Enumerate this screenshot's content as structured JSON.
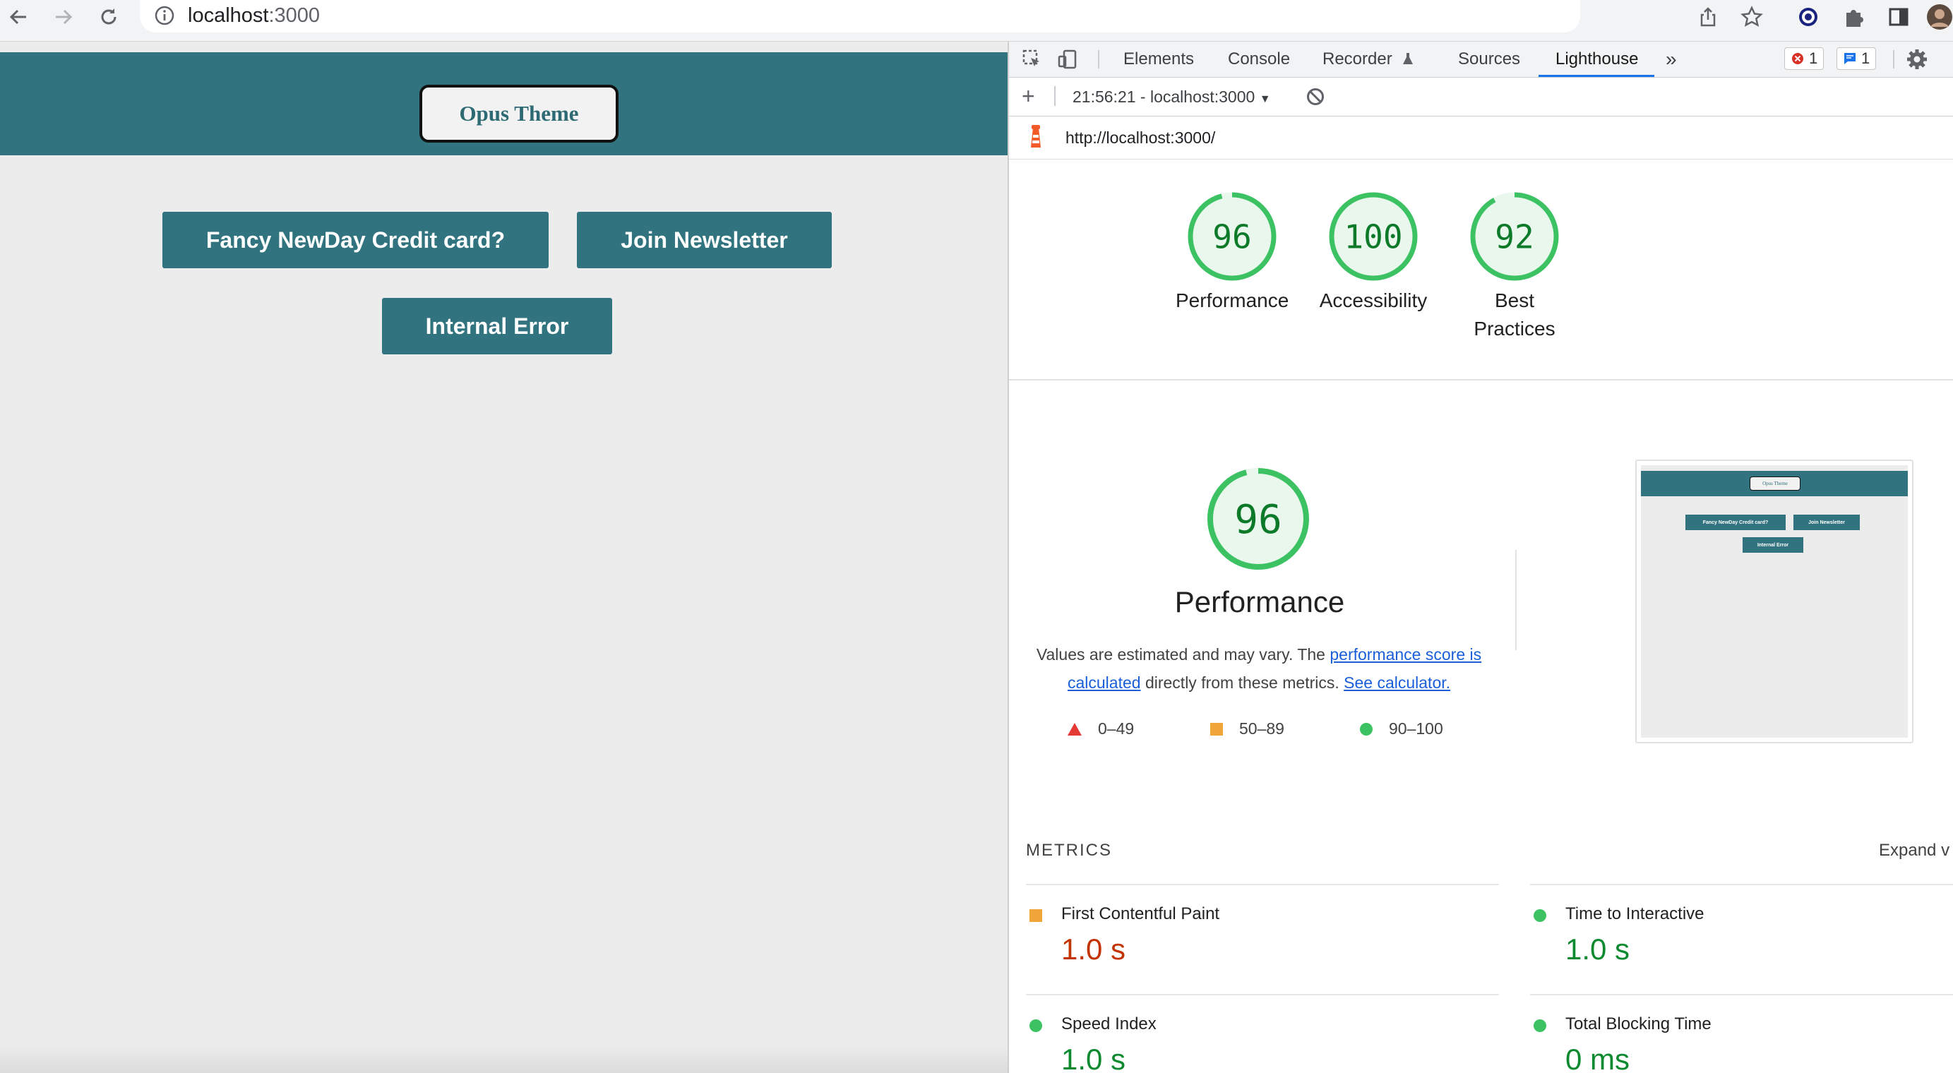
{
  "browser": {
    "url_host": "localhost",
    "url_port": ":3000"
  },
  "page": {
    "header_button": "Opus Theme",
    "buttons": [
      "Fancy NewDay Credit card?",
      "Join Newsletter",
      "Internal Error"
    ]
  },
  "devtools": {
    "tabs": [
      "Elements",
      "Console",
      "Recorder",
      "Sources",
      "Lighthouse"
    ],
    "active_tab": "Lighthouse",
    "error_count": "1",
    "message_count": "1",
    "report_selector": "21:56:21 - localhost:3000",
    "report_url": "http://localhost:3000/",
    "scores": [
      {
        "value": "96",
        "label": "Performance",
        "score": 96
      },
      {
        "value": "100",
        "label": "Accessibility",
        "score": 100
      },
      {
        "value": "92",
        "label": "Best Practices",
        "score": 92
      }
    ],
    "performance": {
      "score_text": "96",
      "score": 96,
      "title": "Performance",
      "desc_start": "Values are estimated and may vary. The ",
      "desc_link1": "performance score is calculated",
      "desc_middle": " directly from these metrics. ",
      "desc_link2": "See calculator.",
      "legend": [
        {
          "range": "0–49",
          "shape": "triangle",
          "color": "#e53935"
        },
        {
          "range": "50–89",
          "shape": "square",
          "color": "#f0a53a"
        },
        {
          "range": "90–100",
          "shape": "circle",
          "color": "#3cc263"
        }
      ]
    },
    "thumbnail": {
      "header_button": "Opus Theme",
      "buttons": [
        "Fancy NewDay Credit card?",
        "Join Newsletter",
        "Internal Error"
      ]
    },
    "metrics_title": "METRICS",
    "expand_label": "Expand v",
    "metrics": [
      {
        "name": "First Contentful Paint",
        "value": "1.0 s",
        "status": "average",
        "color": "#c33300",
        "icon_color": "#f0a53a"
      },
      {
        "name": "Time to Interactive",
        "value": "1.0 s",
        "status": "pass",
        "color": "#0d8a2f",
        "icon_color": "#3cc263"
      },
      {
        "name": "Speed Index",
        "value": "1.0 s",
        "status": "pass",
        "color": "#0d8a2f",
        "icon_color": "#3cc263"
      },
      {
        "name": "Total Blocking Time",
        "value": "0 ms",
        "status": "pass",
        "color": "#0d8a2f",
        "icon_color": "#3cc263"
      }
    ],
    "colors": {
      "pass_ring": "#3cc263",
      "pass_fill": "#e9f7ed",
      "pass_text": "#0d7a2a"
    }
  }
}
